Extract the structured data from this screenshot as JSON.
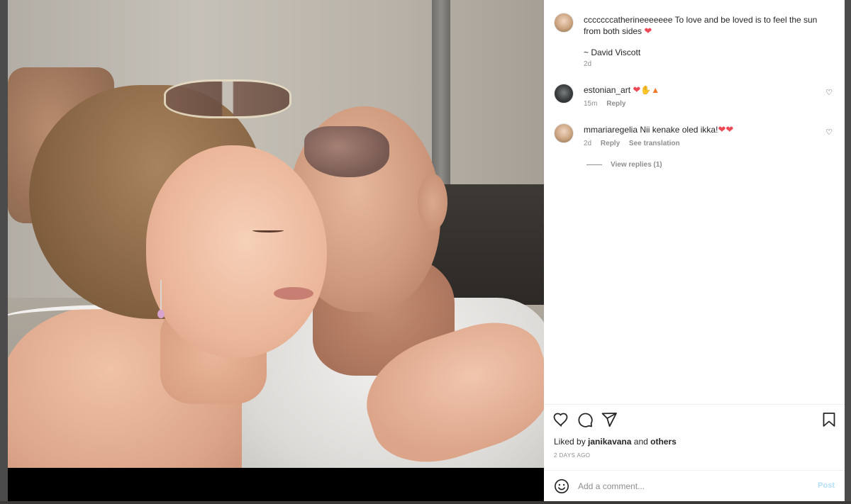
{
  "post": {
    "caption": {
      "username": "cccccccatherineeeeeee",
      "text": "To love and be loved is to feel the sun from both sides",
      "emoji": "heart-red",
      "attribution": "~ David Viscott",
      "age": "2d"
    },
    "comments": [
      {
        "username": "estonian_art",
        "text": "",
        "emojis": [
          "heart-red",
          "clap",
          "fire"
        ],
        "age": "15m",
        "reply_label": "Reply"
      },
      {
        "username": "mmariaregelia",
        "text": "Nii kenake oled ikka!",
        "emojis": [
          "heart-red",
          "heart-red"
        ],
        "age": "2d",
        "reply_label": "Reply",
        "translation_label": "See translation",
        "view_replies_label": "View replies (1)"
      }
    ],
    "likes": {
      "prefix": "Liked by",
      "user": "janikavana",
      "joiner": "and",
      "others": "others"
    },
    "posted_label": "2 DAYS AGO",
    "add_comment": {
      "placeholder": "Add a comment...",
      "post_label": "Post"
    }
  },
  "colors": {
    "heart": "#ed4956",
    "post_button_disabled": "#b2dffc",
    "meta_text": "#8e8e8e"
  }
}
